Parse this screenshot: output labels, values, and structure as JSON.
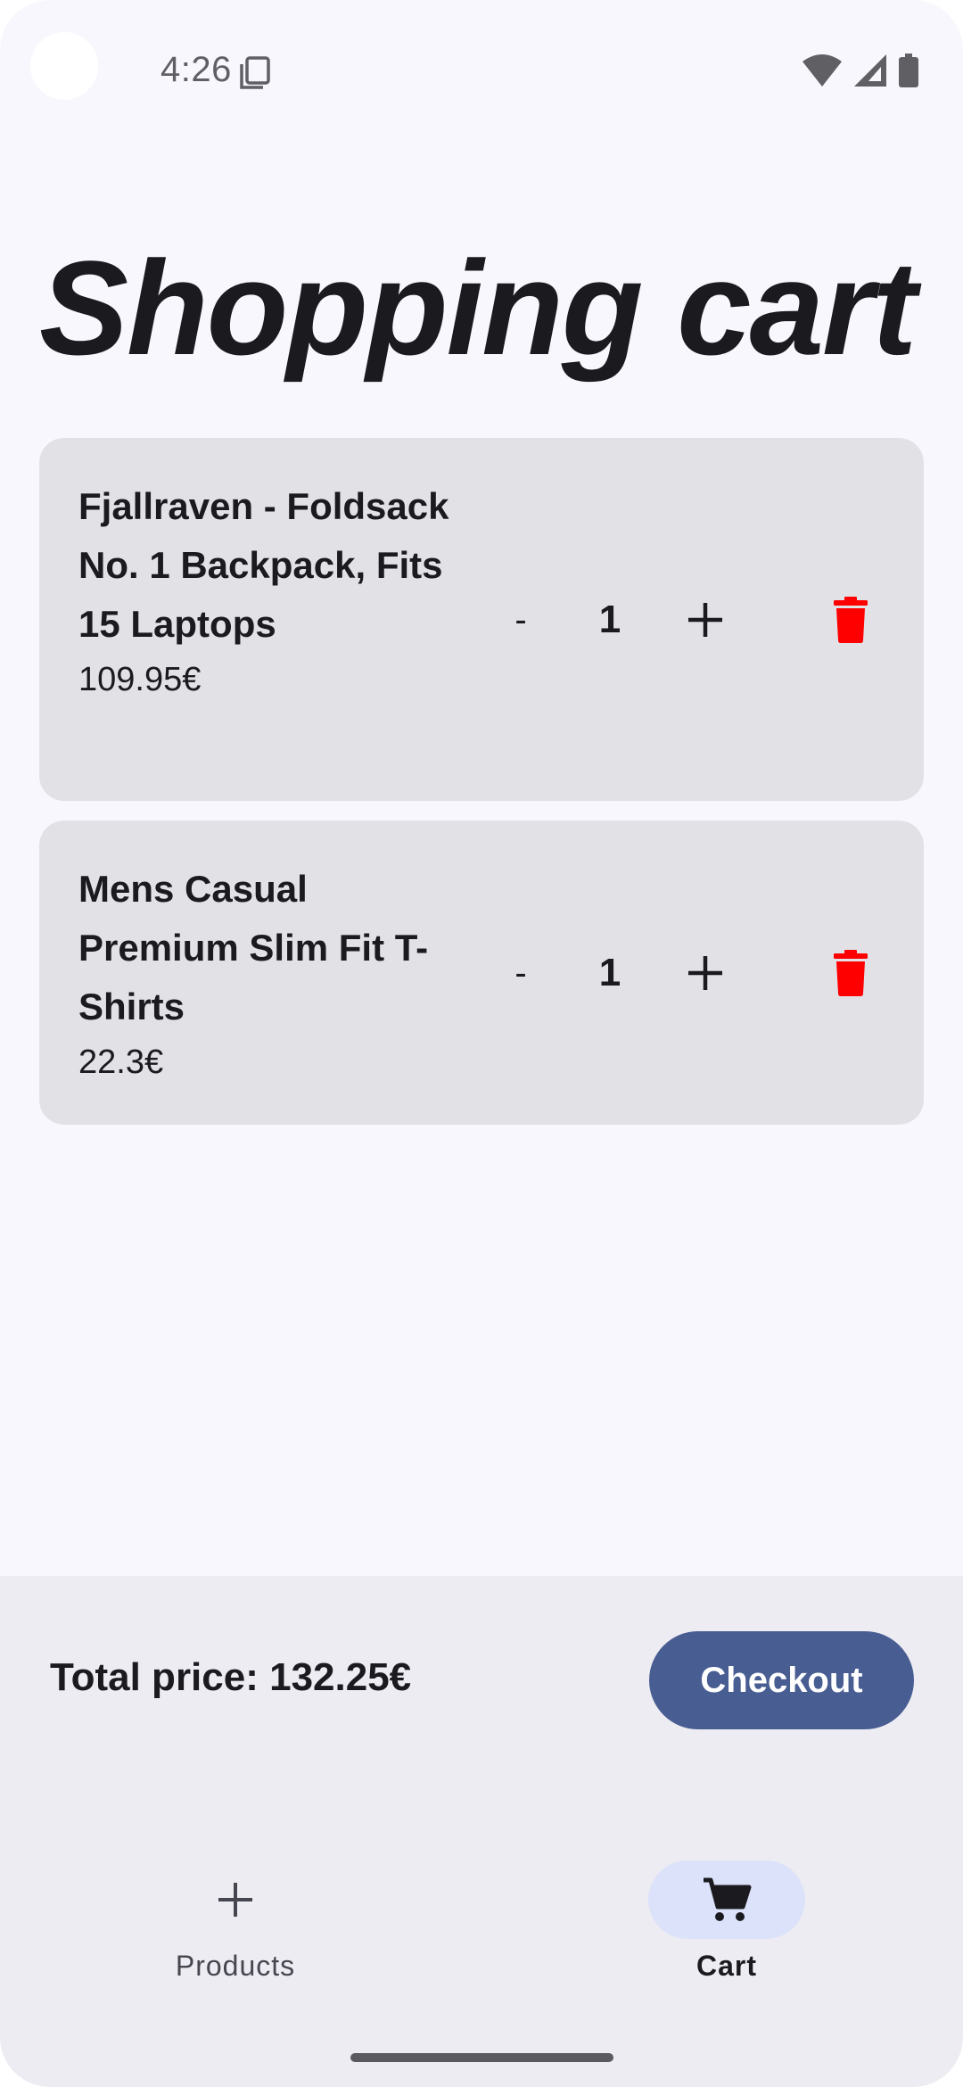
{
  "status_bar": {
    "time": "4:26",
    "icons": [
      "sim-card-icon",
      "wifi-icon",
      "signal-icon",
      "battery-icon"
    ]
  },
  "page": {
    "title": "Shopping cart"
  },
  "cart": {
    "items": [
      {
        "name": "Fjallraven - Foldsack No. 1 Backpack, Fits 15 Laptops",
        "price": "109.95€",
        "quantity": "1",
        "minus_label": "-"
      },
      {
        "name": "Mens Casual Premium Slim Fit T-Shirts",
        "price": "22.3€",
        "quantity": "1",
        "minus_label": "-"
      }
    ]
  },
  "summary": {
    "total_label": "Total price: 132.25€",
    "checkout_label": "Checkout"
  },
  "bottom_nav": {
    "items": [
      {
        "label": "Products",
        "icon": "plus-icon",
        "selected": false
      },
      {
        "label": "Cart",
        "icon": "cart-icon",
        "selected": true
      }
    ]
  },
  "colors": {
    "accent": "#485d92",
    "delete": "#ff0000",
    "card_bg": "#e2e2e6",
    "selected_nav_pill": "#dce2f9"
  }
}
